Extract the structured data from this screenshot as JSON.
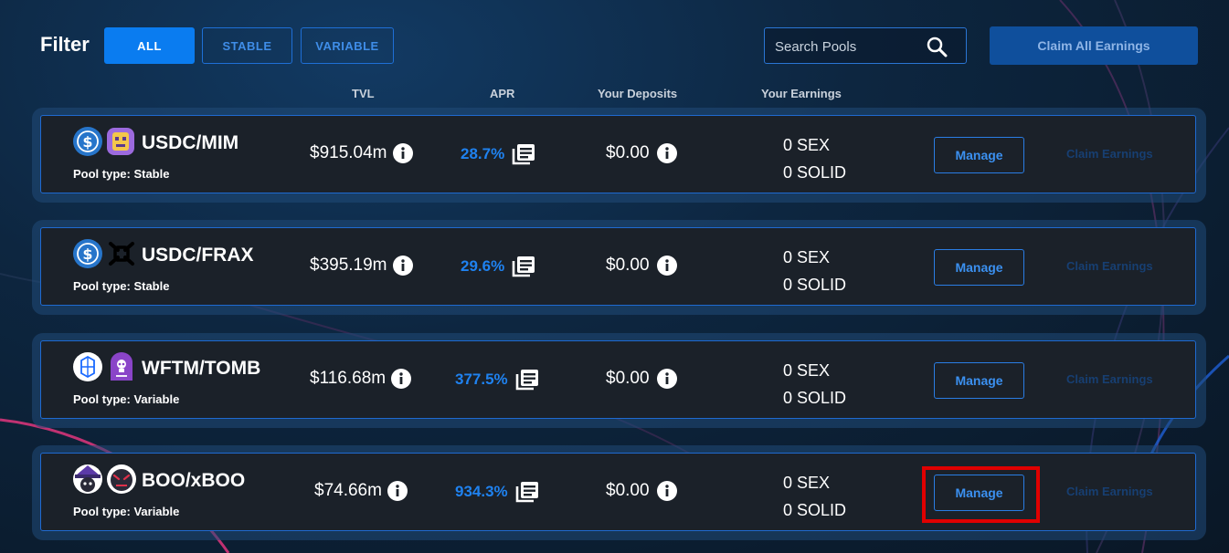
{
  "filter": {
    "label": "Filter",
    "options": [
      "ALL",
      "STABLE",
      "VARIABLE"
    ],
    "active": "ALL"
  },
  "search": {
    "placeholder": "Search Pools"
  },
  "claim_all_label": "Claim All Earnings",
  "columns": {
    "tvl": "TVL",
    "apr": "APR",
    "deposits": "Your Deposits",
    "earnings": "Your Earnings"
  },
  "pools": [
    {
      "name": "USDC/MIM",
      "type": "Pool type: Stable",
      "tvl": "$915.04m",
      "apr": "28.7%",
      "deposits": "$0.00",
      "earn_sex": "0 SEX",
      "earn_solid": "0 SOLID",
      "manage": "Manage",
      "claim": "Claim Earnings",
      "icons": [
        "usdc-icon",
        "mim-icon"
      ]
    },
    {
      "name": "USDC/FRAX",
      "type": "Pool type: Stable",
      "tvl": "$395.19m",
      "apr": "29.6%",
      "deposits": "$0.00",
      "earn_sex": "0 SEX",
      "earn_solid": "0 SOLID",
      "manage": "Manage",
      "claim": "Claim Earnings",
      "icons": [
        "usdc-icon",
        "frax-icon"
      ]
    },
    {
      "name": "WFTM/TOMB",
      "type": "Pool type: Variable",
      "tvl": "$116.68m",
      "apr": "377.5%",
      "deposits": "$0.00",
      "earn_sex": "0 SEX",
      "earn_solid": "0 SOLID",
      "manage": "Manage",
      "claim": "Claim Earnings",
      "icons": [
        "fantom-icon",
        "tomb-icon"
      ]
    },
    {
      "name": "BOO/xBOO",
      "type": "Pool type: Variable",
      "tvl": "$74.66m",
      "apr": "934.3%",
      "deposits": "$0.00",
      "earn_sex": "0 SEX",
      "earn_solid": "0 SOLID",
      "manage": "Manage",
      "claim": "Claim Earnings",
      "icons": [
        "boo-icon",
        "xboo-icon"
      ]
    }
  ],
  "colors": {
    "accent": "#0a7cf0",
    "apr": "#1f82f0",
    "highlight": "#e00000",
    "row_bg": "#1b2129"
  }
}
